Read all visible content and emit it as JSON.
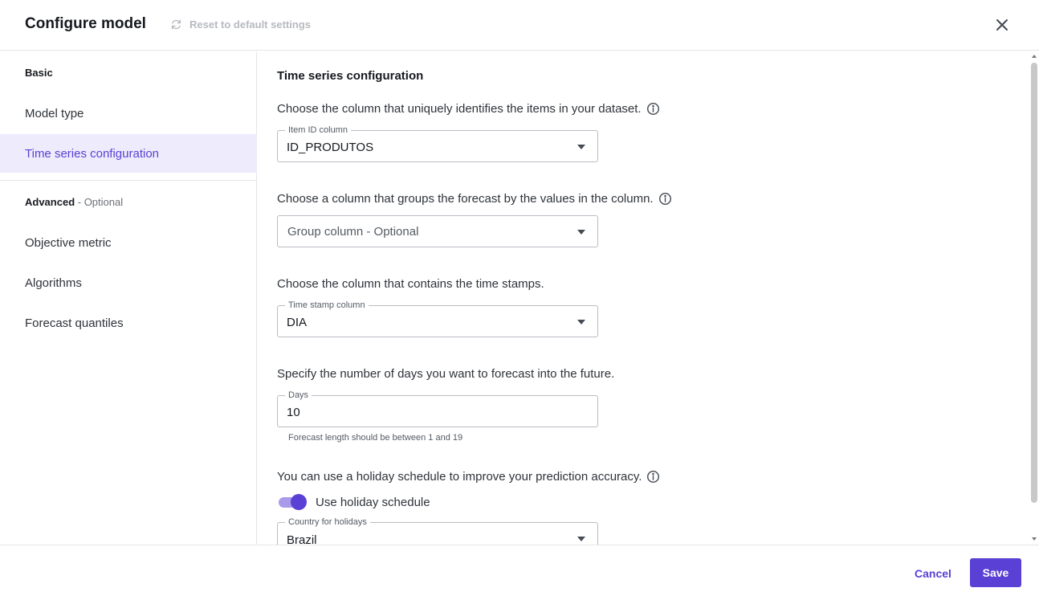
{
  "header": {
    "title": "Configure model",
    "reset_label": "Reset to default settings"
  },
  "sidebar": {
    "basic_heading": "Basic",
    "advanced_heading": "Advanced",
    "advanced_suffix": " - Optional",
    "items": [
      {
        "label": "Model type"
      },
      {
        "label": "Time series configuration",
        "active": true
      },
      {
        "label": "Objective metric"
      },
      {
        "label": "Algorithms"
      },
      {
        "label": "Forecast quantiles"
      }
    ]
  },
  "main": {
    "section_title": "Time series configuration",
    "item_id": {
      "prompt": "Choose the column that uniquely identifies the items in your dataset.",
      "legend": "Item ID column",
      "value": "ID_PRODUTOS"
    },
    "group": {
      "prompt": "Choose a column that groups the forecast by the values in the column.",
      "placeholder": "Group column - Optional"
    },
    "timestamp": {
      "prompt": "Choose the column that contains the time stamps.",
      "legend": "Time stamp column",
      "value": "DIA"
    },
    "days": {
      "prompt": "Specify the number of days you want to forecast into the future.",
      "legend": "Days",
      "value": "10",
      "helper": "Forecast length should be between 1 and 19"
    },
    "holiday": {
      "prompt": "You can use a holiday schedule to improve your prediction accuracy.",
      "toggle_label": "Use holiday schedule",
      "toggle_on": true,
      "country_legend": "Country for holidays",
      "country_value": "Brazil"
    }
  },
  "footer": {
    "cancel_label": "Cancel",
    "save_label": "Save"
  },
  "colors": {
    "accent": "#5a40d4",
    "active_bg": "#eeebfc",
    "toggle_track": "#a99bea"
  }
}
